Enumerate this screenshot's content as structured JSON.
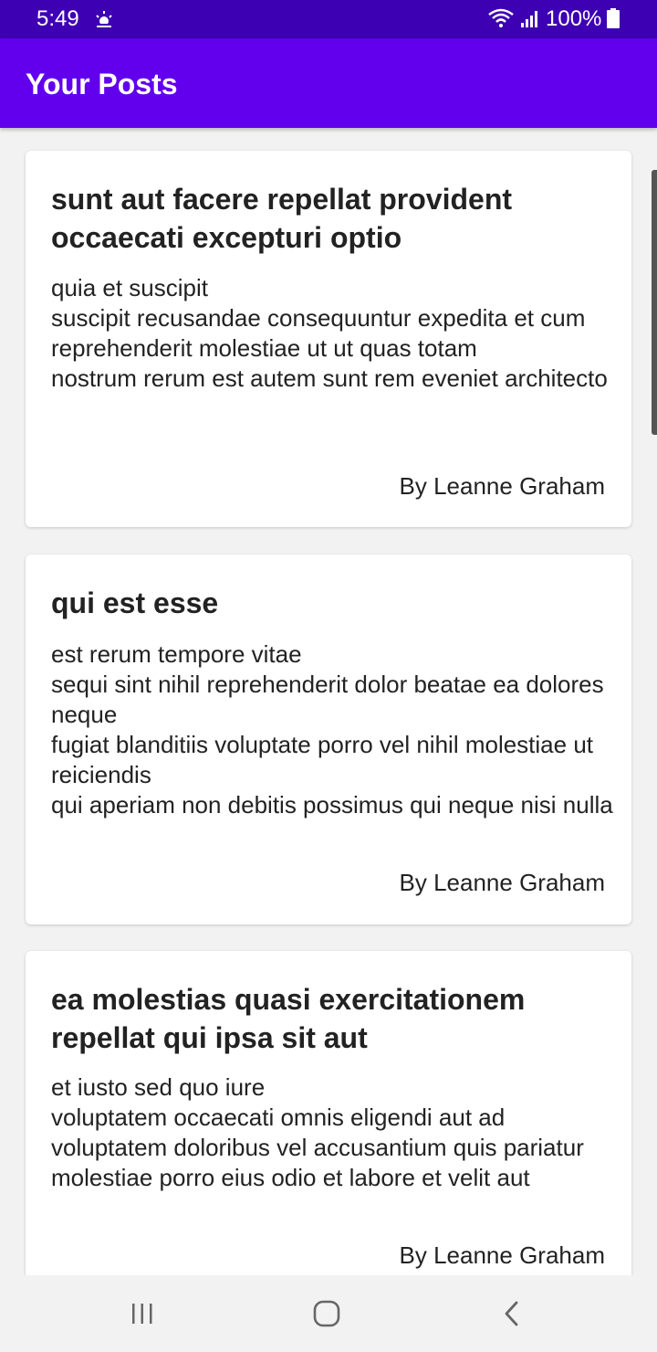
{
  "status_bar": {
    "time": "5:49",
    "weather_icon": "weather-sun-icon",
    "battery": "100%"
  },
  "app_bar": {
    "title": "Your Posts",
    "color": "#6200ee",
    "status_color": "#3d00b3"
  },
  "posts": [
    {
      "title": "sunt aut facere repellat provident occaecati excepturi optio",
      "body": "quia et suscipit\nsuscipit recusandae consequuntur expedita et cum\nreprehenderit molestiae ut ut quas totam\nnostrum rerum est autem sunt rem eveniet architecto",
      "author": "By Leanne Graham"
    },
    {
      "title": "qui est esse",
      "body": "est rerum tempore vitae\nsequi sint nihil reprehenderit dolor beatae ea dolores neque\nfugiat blanditiis voluptate porro vel nihil molestiae ut reiciendis\nqui aperiam non debitis possimus qui neque nisi nulla",
      "author": "By Leanne Graham"
    },
    {
      "title": "ea molestias quasi exercitationem repellat qui ipsa sit aut",
      "body": "et iusto sed quo iure\nvoluptatem occaecati omnis eligendi aut ad\nvoluptatem doloribus vel accusantium quis pariatur\nmolestiae porro eius odio et labore et velit aut",
      "author": "By Leanne Graham"
    }
  ],
  "nav_bar": {
    "recents_icon": "recents-icon",
    "home_icon": "home-icon",
    "back_icon": "back-icon"
  }
}
